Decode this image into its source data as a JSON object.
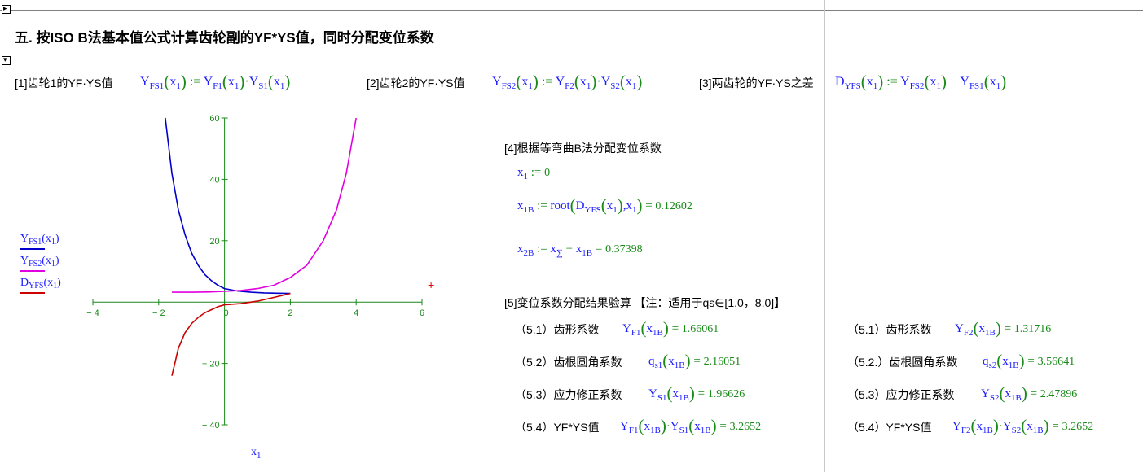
{
  "section": {
    "title": "五. 按ISO B法基本值公式计算齿轮副的YF*YS值，同时分配变位系数"
  },
  "row1": {
    "label1": "[1]齿轮1的YF·YS值",
    "label2": "[2]齿轮2的YF·YS值",
    "label3": "[3]两齿轮的YF·YS之差"
  },
  "section4": {
    "title": "[4]根据等弯曲B法分配变位系数",
    "x1_value": "0",
    "x1B_result": "0.12602",
    "x2B_result": "0.37398"
  },
  "section5": {
    "title": "[5]变位系数分配结果验算 【注：适用于qs∈[1.0，8.0]】",
    "left": [
      {
        "label": "（5.1）齿形系数",
        "result": "1.66061"
      },
      {
        "label": "（5.2）齿根圆角系数",
        "result": "2.16051"
      },
      {
        "label": "（5.3）应力修正系数",
        "result": "1.96626"
      },
      {
        "label": "（5.4）YF*YS值",
        "result": "3.2652"
      }
    ],
    "right": [
      {
        "label": "（5.1）齿形系数",
        "result": "1.31716"
      },
      {
        "label": "（5.2.）齿根圆角系数",
        "result": "3.56641"
      },
      {
        "label": "（5.3）应力修正系数",
        "result": "2.47896"
      },
      {
        "label": "（5.4）YF*YS值",
        "result": "3.2652"
      }
    ]
  },
  "chart_data": {
    "type": "line",
    "xlabel": "x1",
    "xlim": [
      -4,
      6
    ],
    "ylim": [
      -40,
      60
    ],
    "x_ticks": [
      "-4",
      "-2",
      "0",
      "2",
      "4",
      "6"
    ],
    "y_ticks": [
      "60",
      "40",
      "20",
      "-20",
      "-40"
    ],
    "grid": false,
    "legend_placement": "left",
    "series": [
      {
        "name": "YFS1(x1)",
        "color": "#0000cc",
        "x": [
          -1.8,
          -1.6,
          -1.4,
          -1.2,
          -1.0,
          -0.8,
          -0.6,
          -0.4,
          -0.2,
          0.0,
          0.4,
          0.8,
          1.2,
          1.6,
          2.0
        ],
        "y": [
          60,
          42,
          30,
          22,
          16,
          12,
          9,
          7,
          5.5,
          4.4,
          3.6,
          3.2,
          3.0,
          2.9,
          2.8
        ]
      },
      {
        "name": "YFS2(x1)",
        "color": "#e000e0",
        "x": [
          -1.6,
          -1.0,
          -0.5,
          0.0,
          0.5,
          1.0,
          1.5,
          2.0,
          2.5,
          3.0,
          3.4,
          3.7,
          4.0
        ],
        "y": [
          3.2,
          3.2,
          3.3,
          3.5,
          3.8,
          4.4,
          5.5,
          8,
          12,
          20,
          30,
          42,
          60
        ]
      },
      {
        "name": "DYFS(x1)",
        "color": "#cc0000",
        "x": [
          -1.6,
          -1.4,
          -1.2,
          -1.0,
          -0.8,
          -0.6,
          -0.4,
          -0.2,
          0.0,
          0.5,
          1.0,
          1.5,
          2.0
        ],
        "y": [
          -24,
          -15,
          -10,
          -7,
          -5,
          -3.5,
          -2.5,
          -1.5,
          -0.9,
          -0.5,
          0.3,
          1.5,
          2.8
        ]
      }
    ]
  },
  "colors": {
    "math": "#1a1aff",
    "operator": "#1a8a1a",
    "divider": "#808080"
  },
  "icons": {
    "collapse": "collapse-arrow-icon",
    "expand": "expand-arrow-icon",
    "marker": "red-plus-marker-icon"
  }
}
